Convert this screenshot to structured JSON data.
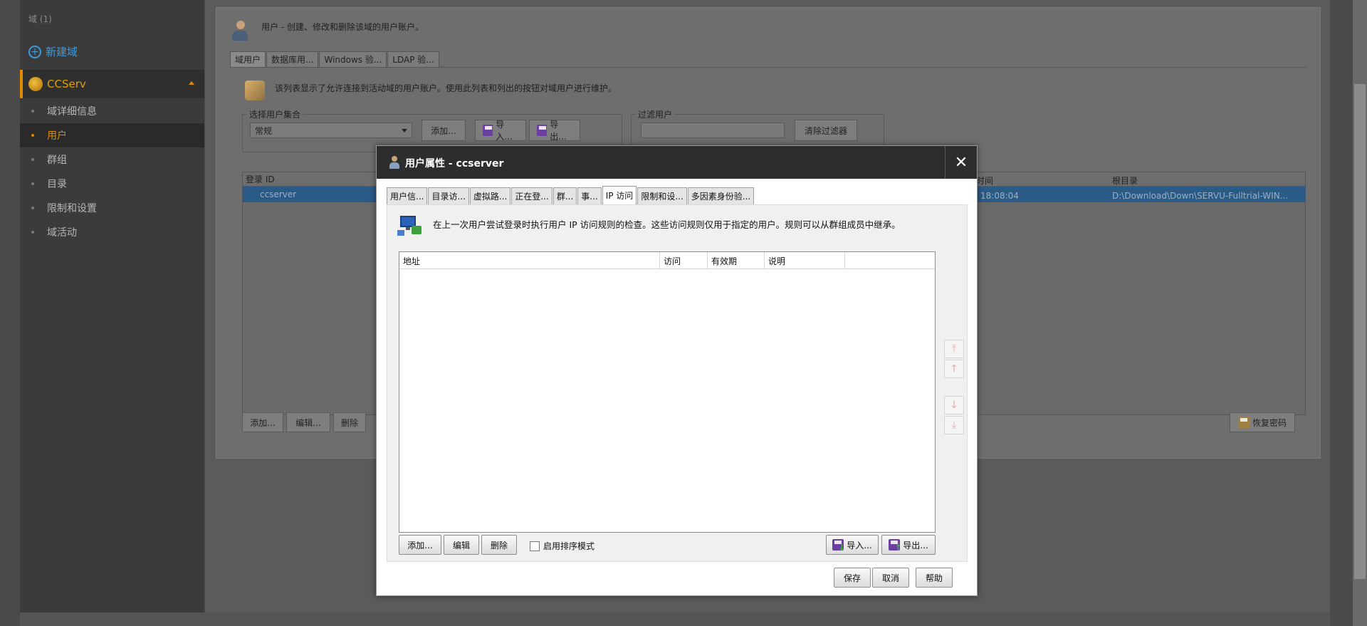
{
  "sidebar": {
    "domain_label": "域 (1)",
    "new_domain": "新建域",
    "domain_name": "CCServ",
    "items": [
      {
        "label": "域详细信息",
        "active": false
      },
      {
        "label": "用户",
        "active": true
      },
      {
        "label": "群组",
        "active": false
      },
      {
        "label": "目录",
        "active": false
      },
      {
        "label": "限制和设置",
        "active": false
      },
      {
        "label": "域活动",
        "active": false
      }
    ]
  },
  "main": {
    "heading_title": "用户",
    "heading_desc": " - 创建、修改和删除该域的用户账户。",
    "tabs": [
      "域用户",
      "数据库用...",
      "Windows 验...",
      "LDAP 验..."
    ],
    "info": "该列表显示了允许连接到活动域的用户账户。使用此列表和列出的按钮对域用户进行维护。",
    "user_set_legend": "选择用户集合",
    "user_set_value": "常规",
    "add_btn": "添加...",
    "import_btn": "导入...",
    "export_btn": "导出...",
    "filter_legend": "过滤用户",
    "clear_filter_btn": "清除过滤器",
    "table_col_login": "登录 ID",
    "table_col_time": "时间",
    "table_col_home": "根目录",
    "row_login": "ccserver",
    "row_time": "18:08:04",
    "row_home": "D:\\Download\\Down\\SERVU-Fulltrial-WIN...",
    "bottom_add": "添加...",
    "bottom_edit": "编辑...",
    "bottom_delete": "删除",
    "recover_pwd": "恢复密码"
  },
  "dialog": {
    "title": "用户属性 - ccserver",
    "tabs": [
      {
        "label": "用户信...",
        "active": false
      },
      {
        "label": "目录访...",
        "active": false
      },
      {
        "label": "虚拟路...",
        "active": false
      },
      {
        "label": "正在登...",
        "active": false
      },
      {
        "label": "群...",
        "active": false
      },
      {
        "label": "事...",
        "active": false
      },
      {
        "label": "IP 访问",
        "active": true
      },
      {
        "label": "限制和设...",
        "active": false
      },
      {
        "label": "多因素身份验...",
        "active": false
      }
    ],
    "description": "在上一次用户尝试登录时执行用户 IP 访问规则的检查。这些访问规则仅用于指定的用户。规则可以从群组成员中继承。",
    "columns": [
      "地址",
      "访问",
      "有效期",
      "说明"
    ],
    "rows": [],
    "add_btn": "添加...",
    "edit_btn": "编辑",
    "delete_btn": "删除",
    "sort_mode_label": "启用排序模式",
    "sort_mode_checked": false,
    "import_btn": "导入...",
    "export_btn": "导出...",
    "save_btn": "保存",
    "cancel_btn": "取消",
    "help_btn": "帮助"
  },
  "colors": {
    "accent": "#e08a00",
    "link": "#3f9ad8",
    "dialog_header": "#2d2d2d"
  }
}
